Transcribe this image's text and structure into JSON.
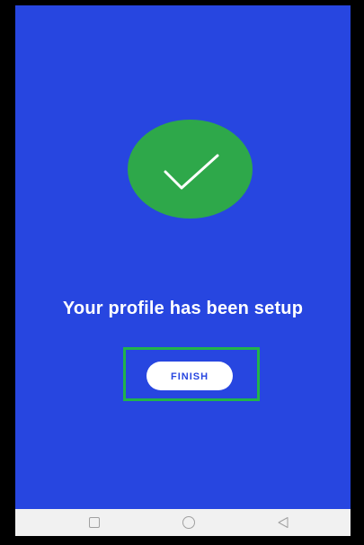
{
  "screen": {
    "message": "Your profile has been setup",
    "finish_label": "FINISH"
  },
  "icons": {
    "success": "checkmark-icon",
    "nav_recent": "square-icon",
    "nav_home": "circle-icon",
    "nav_back": "triangle-back-icon"
  },
  "colors": {
    "background": "#2746e0",
    "success_circle": "#2ea84a",
    "highlight": "#21b34a",
    "button_bg": "#ffffff",
    "button_text": "#2746e0",
    "nav_bar": "#f1f1f1"
  }
}
